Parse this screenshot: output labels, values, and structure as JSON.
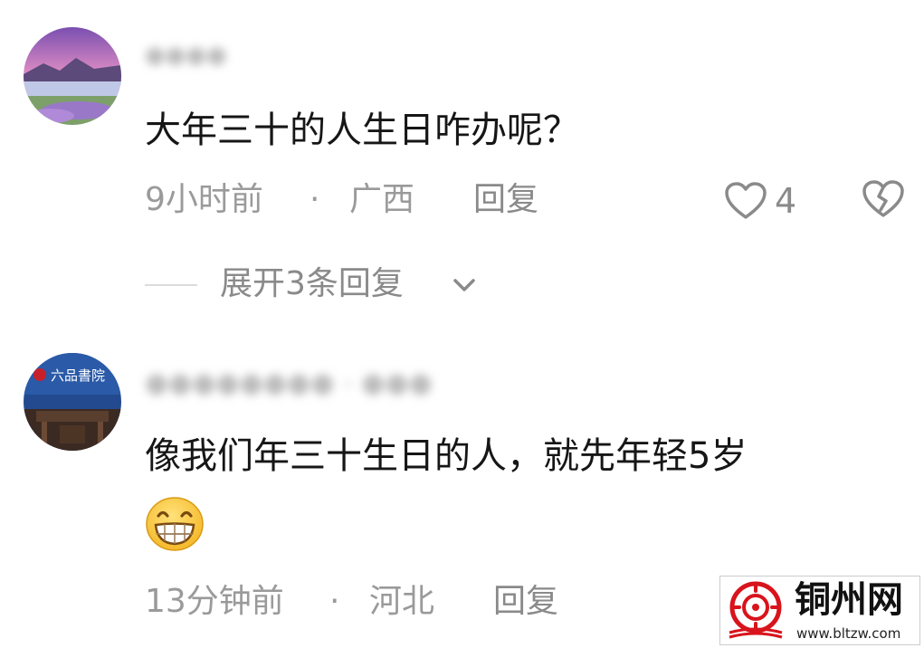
{
  "comments": [
    {
      "username": "●●●●",
      "text": "大年三十的人生日咋办呢？",
      "time": "9小时前",
      "separator": "·",
      "location": "广西",
      "reply_label": "回复",
      "like_count": "4",
      "expand_label": "展开3条回复"
    },
    {
      "username": "●●●●●●●● - ●●●",
      "avatar_text": "六品書院",
      "text_line1": "像我们年三十生日的人，就先年轻5岁",
      "emoji": "grinning-face-icon",
      "time": "13分钟前",
      "separator": "·",
      "location": "河北",
      "reply_label": "回复"
    }
  ],
  "watermark": {
    "title": "铜州网",
    "url": "www.bltzw.com"
  },
  "colors": {
    "text": "#161616",
    "meta": "#9a9a9a",
    "icon": "#8a8a8a",
    "watermark_red": "#d8141c"
  }
}
